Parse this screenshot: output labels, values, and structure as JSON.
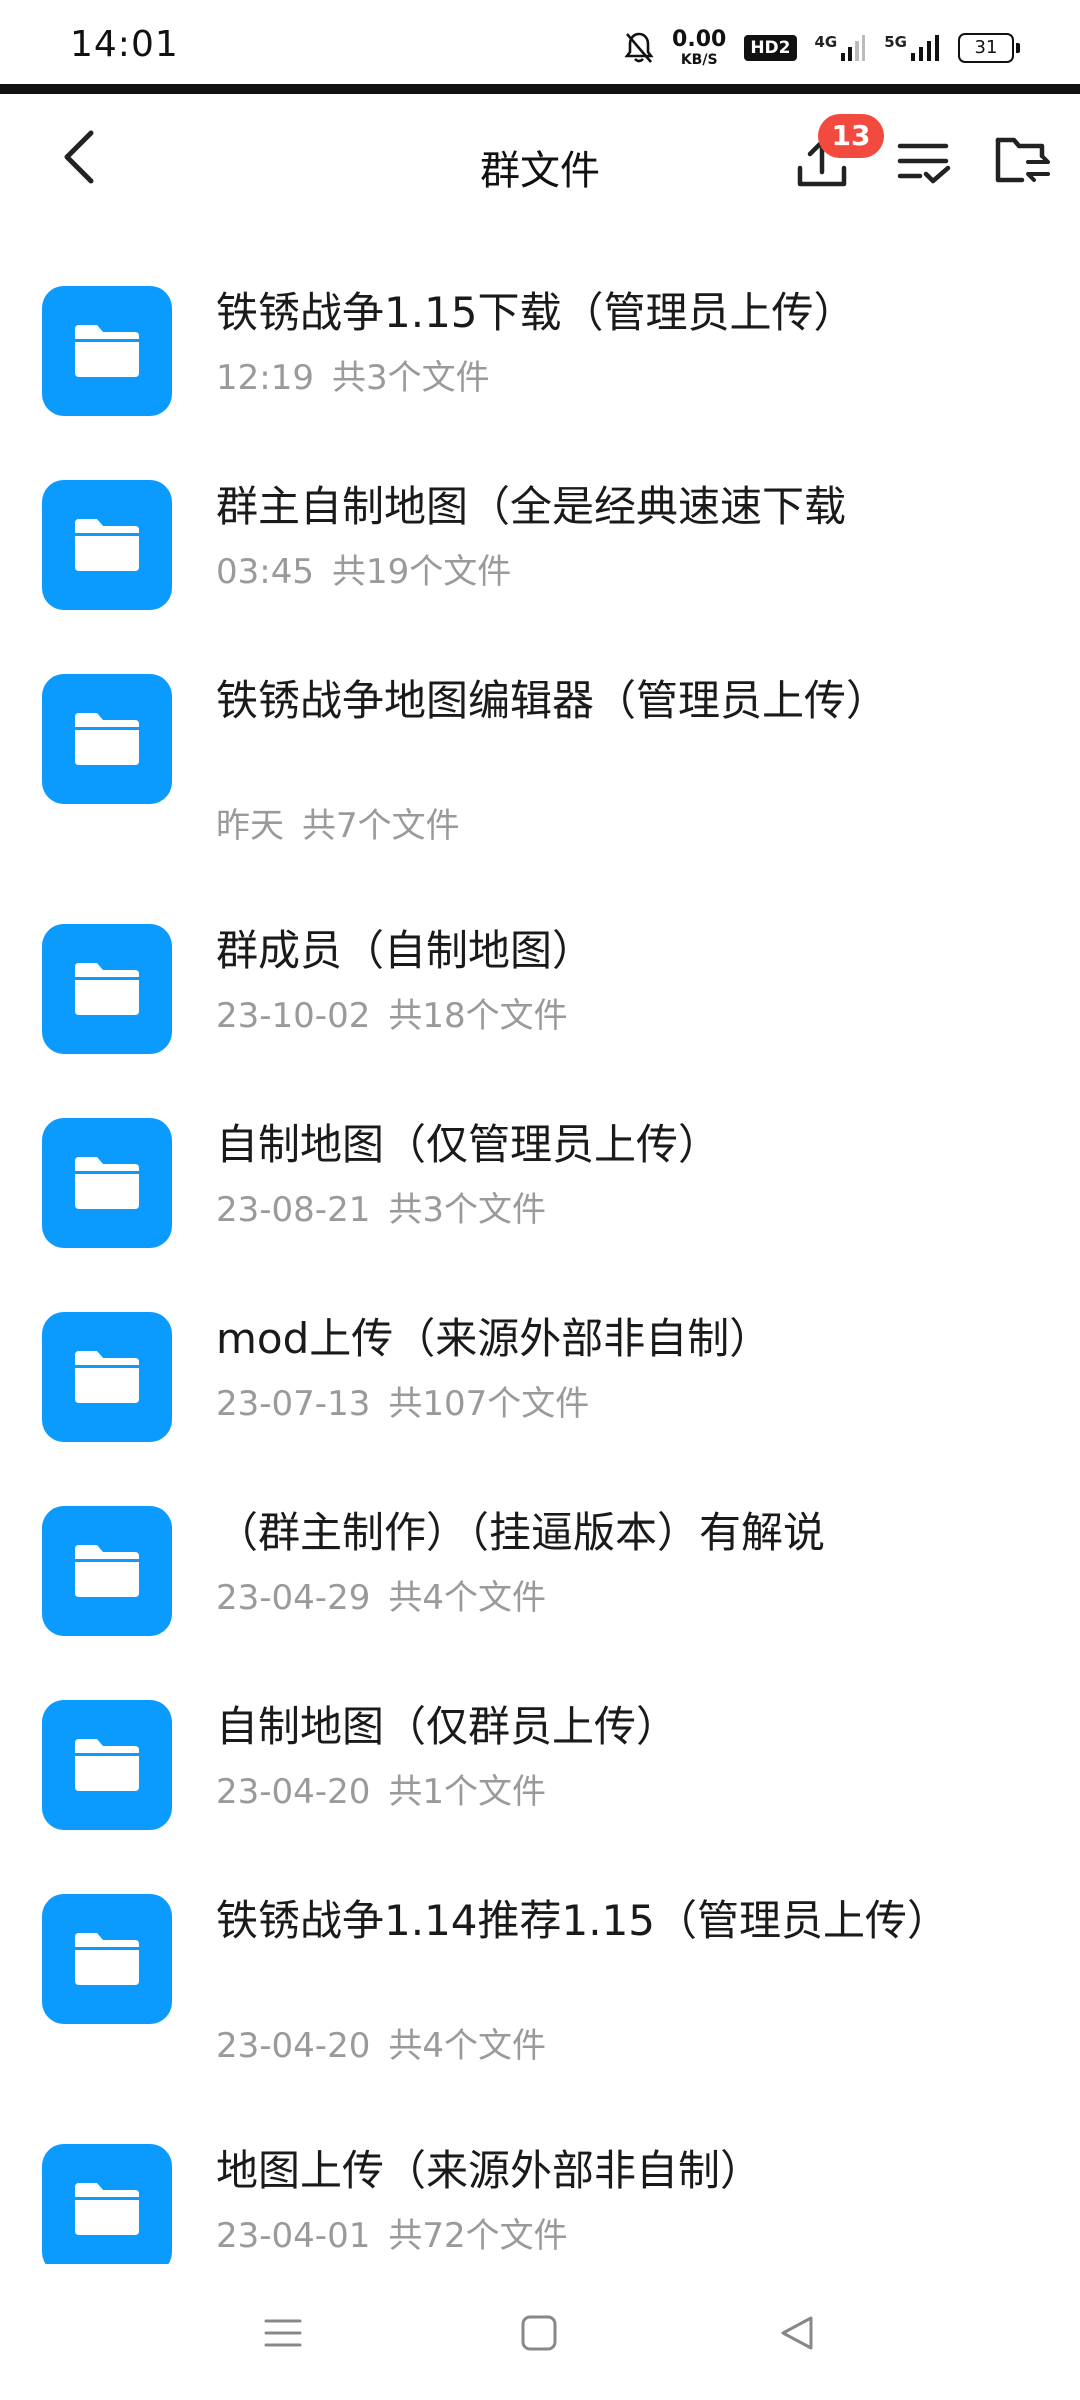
{
  "status_bar": {
    "time": "14:01",
    "net_speed_value": "0.00",
    "net_speed_unit": "KB/S",
    "hd_label": "HD2",
    "signal_1": "4G",
    "signal_2": "5G",
    "battery": "31"
  },
  "header": {
    "title": "群文件",
    "upload_badge": "13"
  },
  "folders": [
    {
      "name": "铁锈战争1.15下载（管理员上传）",
      "date": "12:19",
      "count": "共3个文件"
    },
    {
      "name": "群主自制地图（全是经典速速下载",
      "date": "03:45",
      "count": "共19个文件"
    },
    {
      "name": "铁锈战争地图编辑器（管理员上传）",
      "date": "昨天",
      "count": "共7个文件"
    },
    {
      "name": "群成员（自制地图）",
      "date": "23-10-02",
      "count": "共18个文件"
    },
    {
      "name": "自制地图（仅管理员上传）",
      "date": "23-08-21",
      "count": "共3个文件"
    },
    {
      "name": "mod上传（来源外部非自制）",
      "date": "23-07-13",
      "count": "共107个文件"
    },
    {
      "name": "（群主制作）（挂逼版本）有解说",
      "date": "23-04-29",
      "count": "共4个文件"
    },
    {
      "name": "自制地图（仅群员上传）",
      "date": "23-04-20",
      "count": "共1个文件"
    },
    {
      "name": "铁锈战争1.14推荐1.15（管理员上传）",
      "date": "23-04-20",
      "count": "共4个文件"
    },
    {
      "name": "地图上传（来源外部非自制）",
      "date": "23-04-01",
      "count": "共72个文件"
    }
  ],
  "colors": {
    "folder_icon": "#0b9bff",
    "badge": "#f24a3f",
    "meta_text": "#9a9a9a"
  },
  "icons": {
    "back": "chevron-left-icon",
    "upload": "upload-icon",
    "sort": "sort-check-icon",
    "folder_switch": "folder-switch-icon",
    "folder": "folder-icon",
    "nav_menu": "menu-icon",
    "nav_home": "home-square-icon",
    "nav_back": "back-triangle-icon"
  }
}
